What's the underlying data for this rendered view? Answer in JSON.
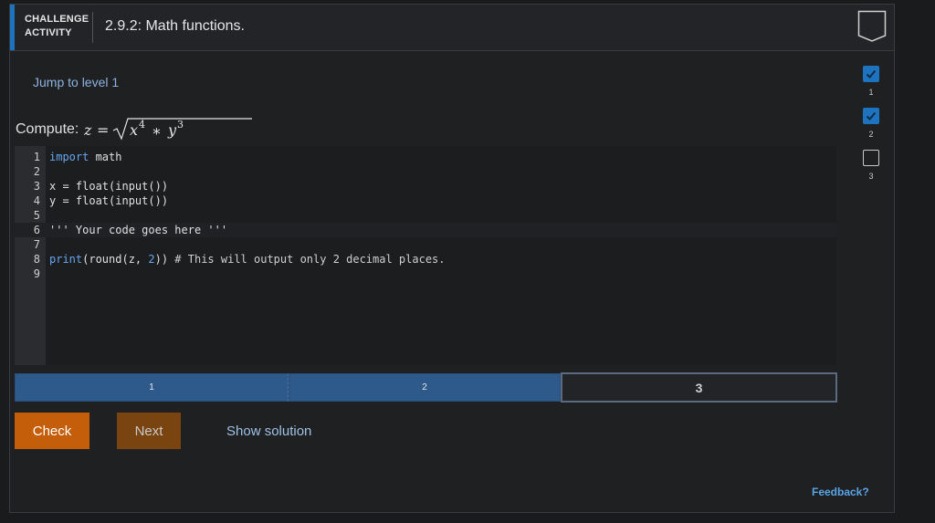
{
  "header": {
    "label_line1": "CHALLENGE",
    "label_line2": "ACTIVITY",
    "title": "2.9.2: Math functions."
  },
  "jump_link": "Jump to level 1",
  "compute_label": "Compute:",
  "editor": {
    "lines": [
      {
        "num": "1",
        "code": "import math"
      },
      {
        "num": "2",
        "code": ""
      },
      {
        "num": "3",
        "code": "x = float(input())"
      },
      {
        "num": "4",
        "code": "y = float(input())"
      },
      {
        "num": "5",
        "code": ""
      },
      {
        "num": "6",
        "code": "''' Your code goes here '''"
      },
      {
        "num": "7",
        "code": ""
      },
      {
        "num": "8",
        "code": "print(round(z, 2)) # This will output only 2 decimal places."
      },
      {
        "num": "9",
        "code": ""
      }
    ]
  },
  "progress": {
    "segments": [
      "1",
      "2",
      "3"
    ],
    "current": "3"
  },
  "buttons": {
    "check": "Check",
    "next": "Next",
    "show_solution": "Show solution"
  },
  "feedback": "Feedback?",
  "levels": [
    {
      "num": "1",
      "status": "done"
    },
    {
      "num": "2",
      "status": "done"
    },
    {
      "num": "3",
      "status": "open"
    }
  ],
  "colors": {
    "accent": "#1e73be",
    "check_button": "#c55e0a",
    "next_button": "#7a4410",
    "progress_fill": "#2d5a8a"
  }
}
